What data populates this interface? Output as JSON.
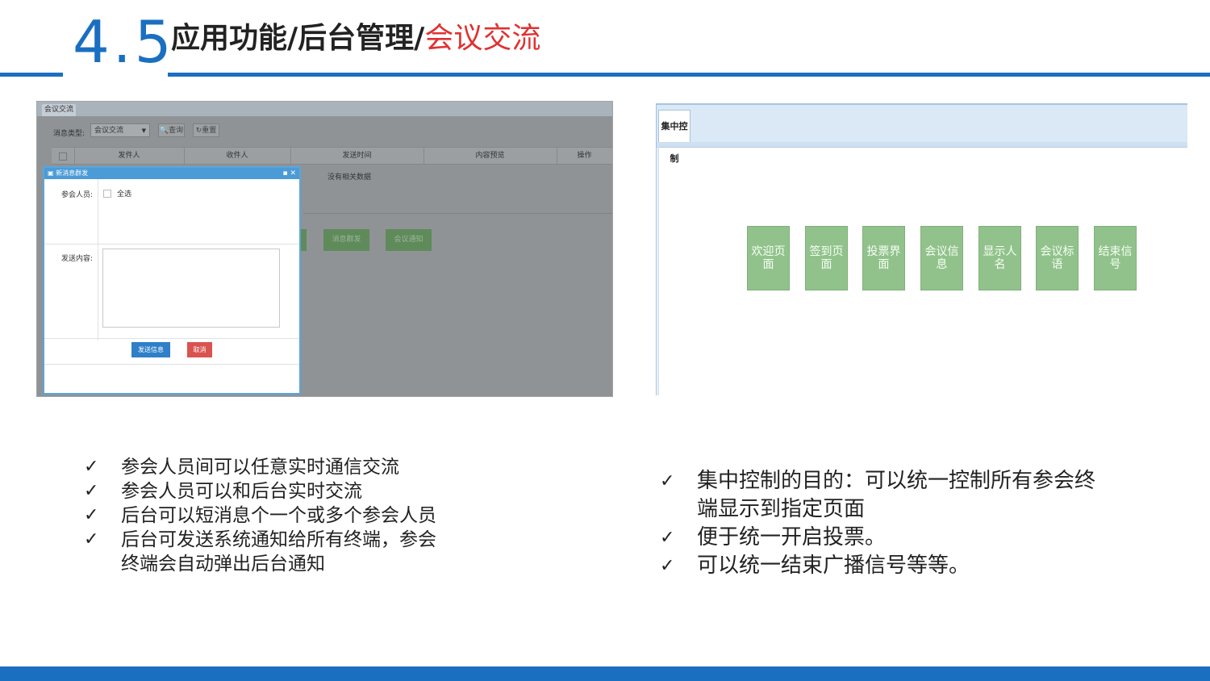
{
  "header": {
    "section_number": "4.5",
    "title_prefix": "应用功能/后台管理/",
    "title_accent": "会议交流"
  },
  "left_screenshot": {
    "tab_label": "会议交流",
    "filter_label": "消息类型:",
    "filter_select_value": "会议交流",
    "query_button": "查询",
    "reset_button": "重置",
    "table_headers": [
      "发件人",
      "收件人",
      "发送时间",
      "内容预览",
      "操作"
    ],
    "empty_text": "没有相关数据",
    "action_buttons": [
      "消息群发",
      "会议通知"
    ],
    "dialog": {
      "title": "新消息群发",
      "participants_label": "参会人员:",
      "select_all_label": "全选",
      "content_label": "发送内容:",
      "send_button": "发送信息",
      "cancel_button": "取消"
    }
  },
  "right_screenshot": {
    "tab_label": "集中控制",
    "tiles": [
      "欢迎页面",
      "签到页面",
      "投票界面",
      "会议信息",
      "显示人名",
      "会议标语",
      "结束信号"
    ]
  },
  "left_bullets": [
    [
      "参会人员间可以任意实时通信交流"
    ],
    [
      "参会人员可以和后台实时交流"
    ],
    [
      "后台可以短消息个一个或多个参会人员"
    ],
    [
      "后台可发送系统通知给所有终端，参会",
      "终端会自动弹出后台通知"
    ]
  ],
  "right_bullets": [
    [
      "集中控制的目的：可以统一控制所有参会终",
      "端显示到指定页面"
    ],
    [
      "便于统一开启投票。"
    ],
    [
      "可以统一结束广播信号等等。"
    ]
  ],
  "check_mark": "✓",
  "colors": {
    "brand_blue": "#1a6fc0",
    "accent_red": "#e03131",
    "tile_green": "#92c28c"
  }
}
